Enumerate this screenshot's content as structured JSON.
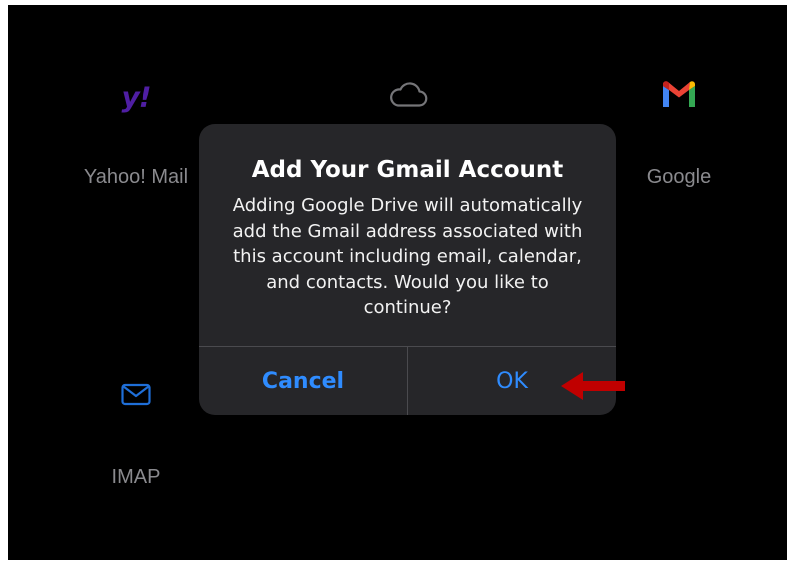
{
  "providers": {
    "yahoo": {
      "logo_text": "y!",
      "label": "Yahoo! Mail"
    },
    "icloud": {
      "icon": "cloud-icon"
    },
    "google": {
      "icon": "gmail-icon",
      "label": "Google"
    },
    "imap": {
      "icon": "envelope-icon",
      "label": "IMAP"
    }
  },
  "dialog": {
    "title": "Add Your Gmail Account",
    "message": "Adding Google Drive will automatically add the Gmail address associated with this account including email, calendar, and contacts. Would you like to continue?",
    "cancel_label": "Cancel",
    "ok_label": "OK"
  },
  "annotation": {
    "arrow_icon": "red-left-arrow-icon",
    "arrow_color": "#c00000"
  },
  "colors": {
    "background": "#000000",
    "dialog_background": "#262629",
    "accent": "#2f8cff",
    "label_gray": "#8a8a8e"
  }
}
